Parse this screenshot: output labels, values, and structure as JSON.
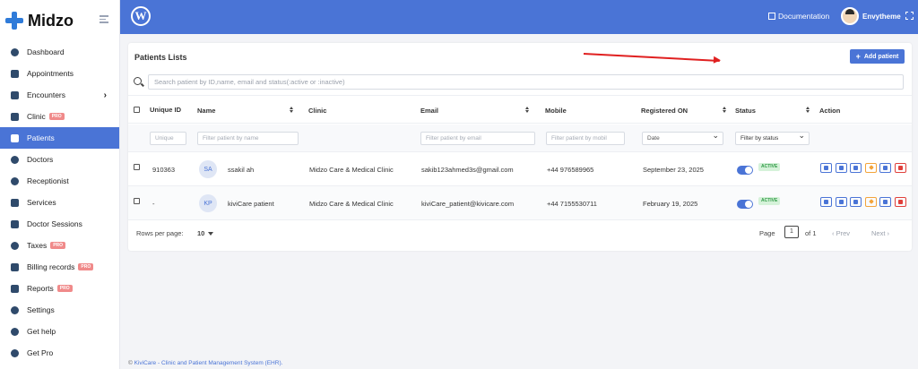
{
  "brand": {
    "name": "Midzo"
  },
  "sidebar": {
    "items": [
      {
        "label": "Dashboard"
      },
      {
        "label": "Appointments"
      },
      {
        "label": "Encounters",
        "has_chevron": true
      },
      {
        "label": "Clinic",
        "badge": "PRO"
      },
      {
        "label": "Patients",
        "active": true
      },
      {
        "label": "Doctors"
      },
      {
        "label": "Receptionist"
      },
      {
        "label": "Services"
      },
      {
        "label": "Doctor Sessions"
      },
      {
        "label": "Taxes",
        "badge": "PRO"
      },
      {
        "label": "Billing records",
        "badge": "PRO"
      },
      {
        "label": "Reports",
        "badge": "PRO"
      },
      {
        "label": "Settings"
      },
      {
        "label": "Get help"
      },
      {
        "label": "Get Pro"
      }
    ]
  },
  "header": {
    "documentation_label": "Documentation",
    "user_name": "Envytheme"
  },
  "card": {
    "title": "Patients Lists",
    "add_button_label": "Add patient",
    "search_placeholder": "Search patient by ID,name, email and status(:active or :inactive)"
  },
  "table": {
    "columns": {
      "unique_id": "Unique ID",
      "name": "Name",
      "clinic": "Clinic",
      "email": "Email",
      "mobile": "Mobile",
      "registered_on": "Registered ON",
      "status": "Status",
      "action": "Action"
    },
    "filters": {
      "unique": "Unique",
      "name": "Filter patient by name",
      "email": "Filter patient by email",
      "mobile": "Filter patient by mobil",
      "date": "Date",
      "status": "Filter by status"
    },
    "rows": [
      {
        "id": "910363",
        "initials": "SA",
        "name": "ssakil ah",
        "clinic": "Midzo Care & Medical Clinic",
        "email": "sakib123ahmed3s@gmail.com",
        "mobile": "+44 976589965",
        "registered": "September 23, 2025",
        "status": "ACTIVE"
      },
      {
        "id": "-",
        "initials": "KP",
        "name": "kiviCare patient",
        "clinic": "Midzo Care & Medical Clinic",
        "email": "kiviCare_patient@kivicare.com",
        "mobile": "+44 7155530711",
        "registered": "February 19, 2025",
        "status": "ACTIVE"
      }
    ]
  },
  "pagination": {
    "rows_per_page_label": "Rows per page:",
    "rows_per_page_value": "10",
    "page_label": "Page",
    "page_value": "1",
    "of_label": "of 1",
    "prev_label": "‹ Prev",
    "next_label": "Next ›"
  },
  "footer": {
    "symbol": "©",
    "text": "KiviCare - Clinic and Patient Management System (EHR)."
  }
}
